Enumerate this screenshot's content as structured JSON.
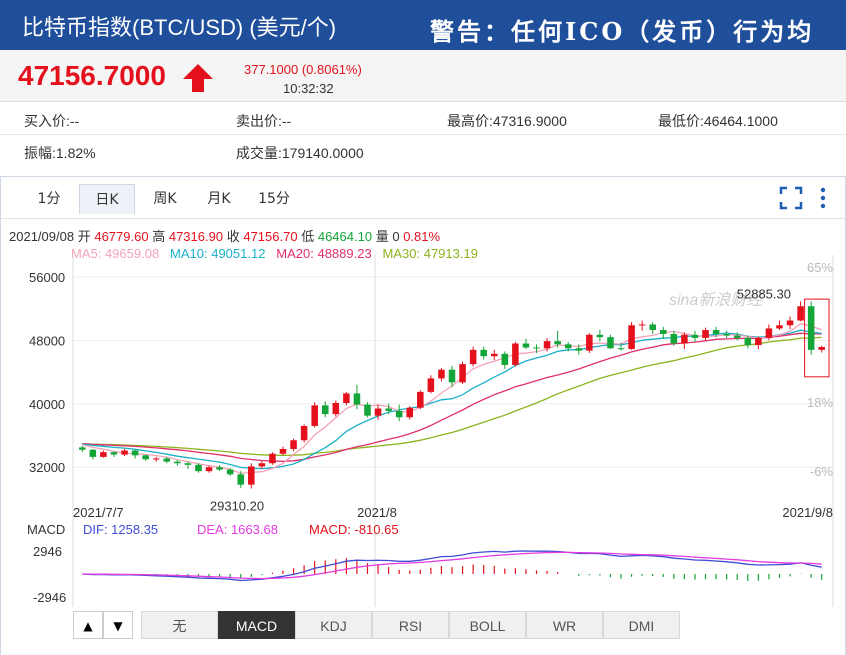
{
  "header": {
    "title": "比特币指数(BTC/USD) (美元/个)",
    "warning": "警告：任何ICO（发币）行为均"
  },
  "quote": {
    "price": "47156.7000",
    "change": "377.1000 (0.8061%)",
    "time": "10:32:32"
  },
  "stats": {
    "bid": "买入价:--",
    "ask": "卖出价:--",
    "high": "最高价:47316.9000",
    "low": "最低价:46464.1000",
    "amplitude": "振幅:1.82%",
    "volume": "成交量:179140.0000"
  },
  "tabs": [
    "1分",
    "日K",
    "周K",
    "月K",
    "15分"
  ],
  "active_tab": "日K",
  "ohlc": {
    "date": "2021/09/08",
    "open_label": "开",
    "open": "46779.60",
    "high_label": "高",
    "high": "47316.90",
    "close_label": "收",
    "close": "47156.70",
    "low_label": "低",
    "low": "46464.10",
    "vol_label": "量",
    "vol": "0",
    "pct": "0.81%"
  },
  "ma_legend": {
    "ma5": "MA5: 49659.08",
    "ma10": "MA10: 49051.12",
    "ma20": "MA20: 48889.23",
    "ma30": "MA30: 47913.19"
  },
  "macd_legend": {
    "label": "MACD",
    "dif": "DIF: 1258.35",
    "dea": "DEA: 1663.68",
    "macd": "MACD: -810.65"
  },
  "watermark": "sina新浪财经",
  "bottom_tabs": [
    "无",
    "MACD",
    "KDJ",
    "RSI",
    "BOLL",
    "WR",
    "DMI"
  ],
  "active_bottom_tab": "MACD",
  "nav_buttons": [
    "▲",
    "▼"
  ],
  "colors": {
    "up": "#e4111d",
    "down": "#13a538",
    "ma5": "#f4a3b8",
    "ma10": "#1ab0c9",
    "ma20": "#e0306c",
    "ma30": "#8cb41e",
    "dif": "#3f4cd6",
    "dea": "#e43be0"
  },
  "chart_data": {
    "type": "candlestick",
    "price_axis": {
      "ticks": [
        56000,
        48000,
        40000,
        32000
      ],
      "ylim": [
        29000,
        57500
      ]
    },
    "pct_axis": {
      "ticks": [
        "65%",
        "18%",
        "-6%"
      ]
    },
    "x_labels": [
      "2021/7/7",
      "2021/8",
      "2021/9/8"
    ],
    "annotations": {
      "max": "52885.30",
      "min": "29310.20"
    },
    "candles": [
      [
        34500,
        34700,
        33900,
        34200
      ],
      [
        34200,
        34300,
        33000,
        33300
      ],
      [
        33300,
        34100,
        33200,
        33900
      ],
      [
        33900,
        34000,
        33300,
        33600
      ],
      [
        33600,
        34300,
        33400,
        34100
      ],
      [
        34100,
        34200,
        33100,
        33500
      ],
      [
        33500,
        33600,
        32800,
        33000
      ],
      [
        33000,
        33300,
        32700,
        33100
      ],
      [
        33100,
        33300,
        32500,
        32700
      ],
      [
        32700,
        32900,
        32200,
        32500
      ],
      [
        32500,
        32700,
        31800,
        32300
      ],
      [
        32300,
        32500,
        31300,
        31500
      ],
      [
        31500,
        32200,
        31300,
        32000
      ],
      [
        32000,
        32300,
        31500,
        31700
      ],
      [
        31700,
        31900,
        30900,
        31100
      ],
      [
        31100,
        31500,
        29400,
        29800
      ],
      [
        29800,
        32500,
        29310,
        32100
      ],
      [
        32100,
        32800,
        31800,
        32500
      ],
      [
        32500,
        33900,
        32300,
        33700
      ],
      [
        33700,
        34600,
        33500,
        34300
      ],
      [
        34300,
        35600,
        34000,
        35400
      ],
      [
        35400,
        37400,
        35100,
        37200
      ],
      [
        37200,
        40200,
        37000,
        39800
      ],
      [
        39800,
        40300,
        38300,
        38700
      ],
      [
        38700,
        40400,
        38400,
        40100
      ],
      [
        40100,
        41500,
        39800,
        41300
      ],
      [
        41300,
        42400,
        39300,
        39900
      ],
      [
        39900,
        40200,
        38300,
        38500
      ],
      [
        38500,
        39900,
        38000,
        39400
      ],
      [
        39400,
        40000,
        38700,
        39100
      ],
      [
        39100,
        39900,
        37800,
        38300
      ],
      [
        38300,
        39700,
        38000,
        39500
      ],
      [
        39500,
        41700,
        39300,
        41500
      ],
      [
        41500,
        43600,
        41300,
        43200
      ],
      [
        43200,
        44500,
        42800,
        44300
      ],
      [
        44300,
        44800,
        42100,
        42700
      ],
      [
        42700,
        45300,
        42500,
        45000
      ],
      [
        45000,
        47200,
        44700,
        46800
      ],
      [
        46800,
        47200,
        45600,
        46000
      ],
      [
        46000,
        46800,
        45500,
        46300
      ],
      [
        46300,
        46600,
        44400,
        44900
      ],
      [
        44900,
        47800,
        44700,
        47600
      ],
      [
        47600,
        48200,
        46900,
        47100
      ],
      [
        47100,
        47500,
        46400,
        47000
      ],
      [
        47000,
        48300,
        46600,
        47900
      ],
      [
        47900,
        49200,
        47100,
        47500
      ],
      [
        47500,
        47800,
        46600,
        47000
      ],
      [
        47000,
        47500,
        46200,
        46700
      ],
      [
        46700,
        48900,
        46400,
        48700
      ],
      [
        48700,
        49300,
        47900,
        48400
      ],
      [
        48400,
        48700,
        46900,
        47000
      ],
      [
        47000,
        47700,
        46700,
        46900
      ],
      [
        46900,
        50300,
        46800,
        49900
      ],
      [
        49900,
        50500,
        49200,
        50000
      ],
      [
        50000,
        50300,
        48800,
        49300
      ],
      [
        49300,
        49700,
        48200,
        48800
      ],
      [
        48800,
        49200,
        47300,
        47600
      ],
      [
        47600,
        49000,
        46900,
        48700
      ],
      [
        48700,
        49200,
        47800,
        48300
      ],
      [
        48300,
        49600,
        47900,
        49300
      ],
      [
        49300,
        49700,
        48400,
        48800
      ],
      [
        48800,
        49200,
        48300,
        48600
      ],
      [
        48600,
        49000,
        48000,
        48300
      ],
      [
        48300,
        48600,
        47000,
        47400
      ],
      [
        47400,
        48500,
        46900,
        48300
      ],
      [
        48300,
        50000,
        48000,
        49500
      ],
      [
        49500,
        50500,
        49300,
        49900
      ],
      [
        49900,
        51000,
        49400,
        50500
      ],
      [
        50500,
        52900,
        50400,
        52300
      ],
      [
        52300,
        52885,
        46200,
        46800
      ],
      [
        46800,
        47317,
        46464,
        47156
      ]
    ],
    "macd": {
      "ylim": [
        -4500,
        4500
      ],
      "ticks": [
        2946,
        -2946
      ]
    }
  }
}
